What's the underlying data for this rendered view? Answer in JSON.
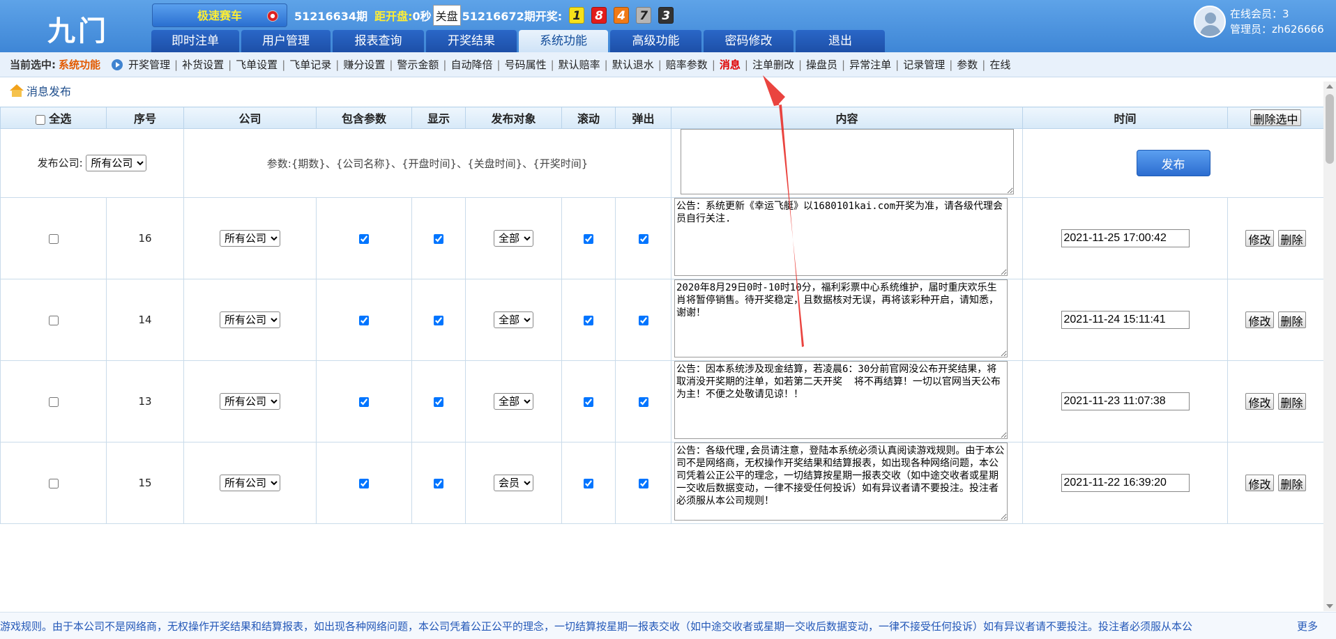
{
  "header": {
    "logo": "九门",
    "game": "极速赛车",
    "current_period": "51216634期",
    "countdown_label": "距开盘:",
    "countdown_value": "0秒",
    "close_status": "关盘",
    "last_period_label": "51216672期开奖:",
    "draw_numbers": [
      {
        "num": "1",
        "color": "#f7e11a",
        "text_color": "#222"
      },
      {
        "num": "8",
        "color": "#e21b1b",
        "text_color": "#fff"
      },
      {
        "num": "4",
        "color": "#f07a16",
        "text_color": "#fff"
      },
      {
        "num": "7",
        "color": "#b5b5b5",
        "text_color": "#222"
      },
      {
        "num": "3",
        "color": "#333333",
        "text_color": "#fff"
      }
    ],
    "online_members": "在线会员：3",
    "admin": "管理员：zh626666"
  },
  "main_nav": [
    {
      "label": "即时注单"
    },
    {
      "label": "用户管理"
    },
    {
      "label": "报表查询"
    },
    {
      "label": "开奖结果"
    },
    {
      "label": "系统功能"
    },
    {
      "label": "高级功能"
    },
    {
      "label": "密码修改"
    },
    {
      "label": "退出"
    }
  ],
  "subnav": {
    "current_label": "当前选中:",
    "current_value": "系统功能",
    "items": [
      "开奖管理",
      "补货设置",
      "飞单设置",
      "飞单记录",
      "赚分设置",
      "警示金额",
      "自动降倍",
      "号码属性",
      "默认赔率",
      "默认退水",
      "赔率参数",
      "消息",
      "注单删改",
      "操盘员",
      "异常注单",
      "记录管理",
      "参数",
      "在线"
    ],
    "active": "消息"
  },
  "page_title": "消息发布",
  "table": {
    "headers": {
      "select_all": "全选",
      "seq": "序号",
      "company": "公司",
      "include_params": "包含参数",
      "display": "显示",
      "target": "发布对象",
      "scroll": "滚动",
      "popup": "弹出",
      "content": "内容",
      "time": "时间",
      "delete_selected": "删除选中"
    },
    "publish_row": {
      "company_label": "发布公司:",
      "company_option": "所有公司",
      "params_hint": "参数:{期数}、{公司名称}、{开盘时间}、{关盘时间}、{开奖时间}",
      "publish_button": "发布"
    },
    "rows": [
      {
        "seq": "16",
        "company": "所有公司",
        "target": "全部",
        "content": "公告：系统更新《幸运飞艇》以1680101kai.com开奖为准，请各级代理会员自行关注.",
        "time": "2021-11-25 17:00:42"
      },
      {
        "seq": "14",
        "company": "所有公司",
        "target": "全部",
        "content": "2020年8月29日0时-10时10分，福利彩票中心系统维护，届时重庆欢乐生肖将暂停销售。待开奖稳定，且数据核对无误，再将该彩种开启，请知悉，谢谢！",
        "time": "2021-11-24 15:11:41"
      },
      {
        "seq": "13",
        "company": "所有公司",
        "target": "全部",
        "content": "公告：因本系统涉及现金结算，若凌晨6：30分前官网没公布开奖结果，将取消没开奖期的注单，如若第二天开奖  将不再结算！一切以官网当天公布为主！不便之处敬请见谅！！",
        "time": "2021-11-23 11:07:38"
      },
      {
        "seq": "15",
        "company": "所有公司",
        "target": "会员",
        "content": "公告：各级代理,会员请注意，登陆本系统必须认真阅读游戏规则。由于本公司不是网络商，无权操作开奖结果和结算报表，如出现各种网络问题，本公司凭着公正公平的理念，一切结算按星期一报表交收（如中途交收者或星期一交收后数据变动，一律不接受任何投诉）如有异议者请不要投注。投注者必须服从本公司规则！",
        "time": "2021-11-22 16:39:20"
      }
    ],
    "row_actions": {
      "edit": "修改",
      "delete": "删除"
    }
  },
  "marquee": {
    "text": "游戏规则。由于本公司不是网络商，无权操作开奖结果和结算报表，如出现各种网络问题，本公司凭着公正公平的理念，一切结算按星期一报表交收（如中途交收者或星期一交收后数据变动，一律不接受任何投诉）如有异议者请不要投注。投注者必须服从本公",
    "more": "更多"
  },
  "colors": {
    "header_blue": "#3e86d6",
    "nav_dark": "#1d4fa8",
    "accent_orange": "#e35a00",
    "active_red": "#e00000",
    "arrow_red": "#e8302a"
  }
}
